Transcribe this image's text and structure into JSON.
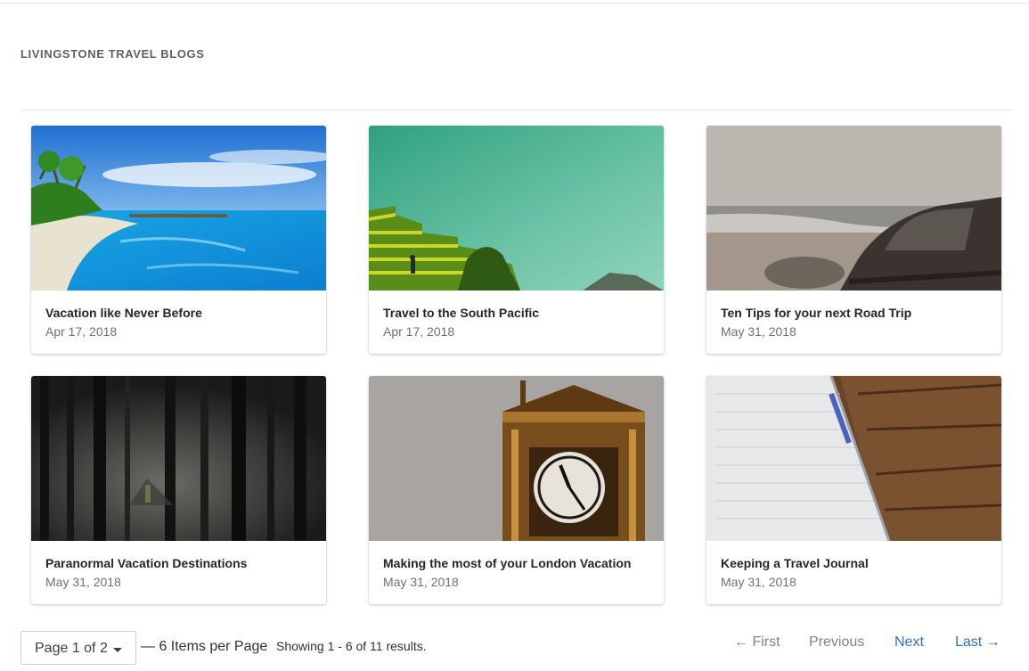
{
  "header": {
    "title": "LIVINGSTONE TRAVEL BLOGS"
  },
  "posts": [
    {
      "title": "Vacation like Never Before",
      "date": "Apr 17, 2018"
    },
    {
      "title": "Travel to the South Pacific",
      "date": "Apr 17, 2018"
    },
    {
      "title": "Ten Tips for your next Road Trip",
      "date": "May 31, 2018"
    },
    {
      "title": "Paranormal Vacation Destinations",
      "date": "May 31, 2018"
    },
    {
      "title": "Making the most of your London Vacation",
      "date": "May 31, 2018"
    },
    {
      "title": "Keeping a Travel Journal",
      "date": "May 31, 2018"
    }
  ],
  "pagination": {
    "page_select": "Page 1 of 2",
    "per_page": "— 6 Items per Page",
    "results": "Showing 1 - 6 of 11 results.",
    "first": "← First",
    "previous": "Previous",
    "next": "Next",
    "last": "Last →"
  },
  "colors": {
    "link": "#2f6fd3",
    "disabled": "#7d828b",
    "heading": "#5b616b"
  }
}
